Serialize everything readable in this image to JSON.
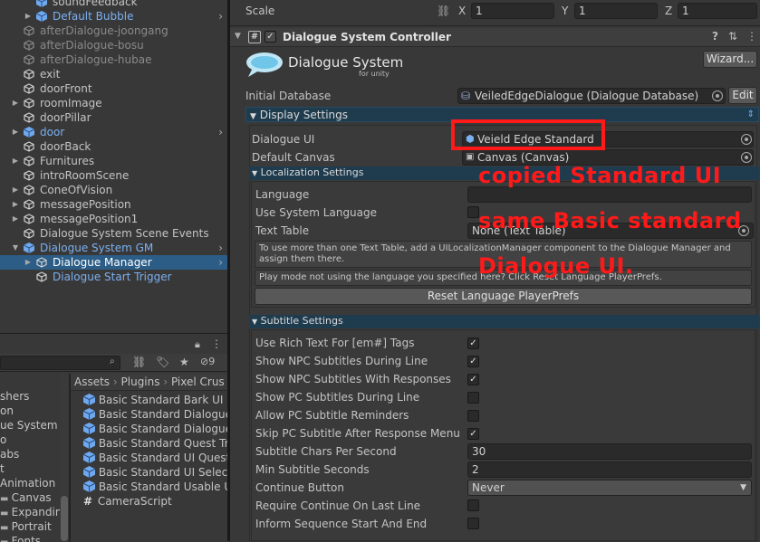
{
  "hierarchy": {
    "items": [
      {
        "label": "soundFeedback",
        "cls": ""
      },
      {
        "label": "Default Bubble",
        "cls": "blue"
      },
      {
        "label": "afterDialogue-joongang",
        "cls": "grey"
      },
      {
        "label": "afterDialogue-bosu",
        "cls": "grey"
      },
      {
        "label": "afterDialogue-hubae",
        "cls": "grey"
      },
      {
        "label": "exit",
        "cls": ""
      },
      {
        "label": "doorFront",
        "cls": ""
      },
      {
        "label": "roomImage",
        "cls": ""
      },
      {
        "label": "doorPillar",
        "cls": ""
      },
      {
        "label": "door",
        "cls": "blue"
      },
      {
        "label": "doorBack",
        "cls": ""
      },
      {
        "label": "Furnitures",
        "cls": ""
      },
      {
        "label": "introRoomScene",
        "cls": ""
      },
      {
        "label": "ConeOfVision",
        "cls": ""
      },
      {
        "label": "messagePosition",
        "cls": ""
      },
      {
        "label": "messagePosition1",
        "cls": ""
      },
      {
        "label": "Dialogue System Scene Events",
        "cls": ""
      },
      {
        "label": "Dialogue System GM",
        "cls": "blue"
      },
      {
        "label": "Dialogue Manager",
        "cls": "sel"
      },
      {
        "label": "Dialogue Start Trigger",
        "cls": "blue"
      }
    ]
  },
  "project": {
    "badge_count": "9",
    "breadcrumb": [
      "Assets",
      "Plugins",
      "Pixel Crus"
    ],
    "left_items": [
      "shers",
      "on",
      "ue System",
      "o",
      "abs",
      "t",
      "Animation",
      "Canvas",
      "Expandin",
      "Portrait",
      "Fonts"
    ],
    "assets": [
      "Basic Standard Bark UI",
      "Basic Standard Dialogue",
      "Basic Standard Dialogue",
      "Basic Standard Quest Tra",
      "Basic Standard UI Quest",
      "Basic Standard UI Select",
      "Basic Standard Usable U",
      "CameraScript"
    ]
  },
  "inspector": {
    "scale": {
      "label": "Scale",
      "x_label": "X",
      "x": "1",
      "y_label": "Y",
      "y": "1",
      "z_label": "Z",
      "z": "1"
    },
    "component_title": "Dialogue System Controller",
    "logo_title": "Dialogue System",
    "logo_sub": "for unity",
    "wizard_label": "Wizard...",
    "initial_db_label": "Initial Database",
    "initial_db_value": "VeiledEdgeDialogue (Dialogue Database)",
    "edit_label": "Edit",
    "display_settings": "Display Settings",
    "dialogue_ui_label": "Dialogue UI",
    "dialogue_ui_value": "Veield Edge Standard",
    "default_canvas_label": "Default Canvas",
    "default_canvas_value": "Canvas (Canvas)",
    "localization_settings": "Localization Settings",
    "language_label": "Language",
    "use_system_language_label": "Use System Language",
    "text_table_label": "Text Table",
    "text_table_value": "None (Text Table)",
    "help_text_1": "To use more than one Text Table, add a UILocalizationManager component to the Dialogue Manager and assign them there.",
    "help_text_2": "Play mode not using the language you specified here? Click Reset Language PlayerPrefs.",
    "reset_button": "Reset Language PlayerPrefs",
    "subtitle_settings": "Subtitle Settings",
    "subtitle_rows": [
      {
        "label": "Use Rich Text For [em#] Tags",
        "checked": true
      },
      {
        "label": "Show NPC Subtitles During Line",
        "checked": true
      },
      {
        "label": "Show NPC Subtitles With Responses",
        "checked": true
      },
      {
        "label": "Show PC Subtitles During Line",
        "checked": false
      },
      {
        "label": "Allow PC Subtitle Reminders",
        "checked": false
      },
      {
        "label": "Skip PC Subtitle After Response Menu",
        "checked": true
      }
    ],
    "chars_per_second_label": "Subtitle Chars Per Second",
    "chars_per_second_value": "30",
    "min_seconds_label": "Min Subtitle Seconds",
    "min_seconds_value": "2",
    "continue_button_label": "Continue Button",
    "continue_button_value": "Never",
    "require_continue_label": "Require Continue On Last Line",
    "inform_sequence_label": "Inform Sequence Start And End"
  },
  "annotations": {
    "line1": "copied Standard UI",
    "line2": "same Basic standard",
    "line3": "Dialogue UI."
  },
  "colors": {
    "annotation_red": "#ff1a1a",
    "selection_blue": "#2c5d87",
    "prefab_blue": "#7bb0f0"
  }
}
